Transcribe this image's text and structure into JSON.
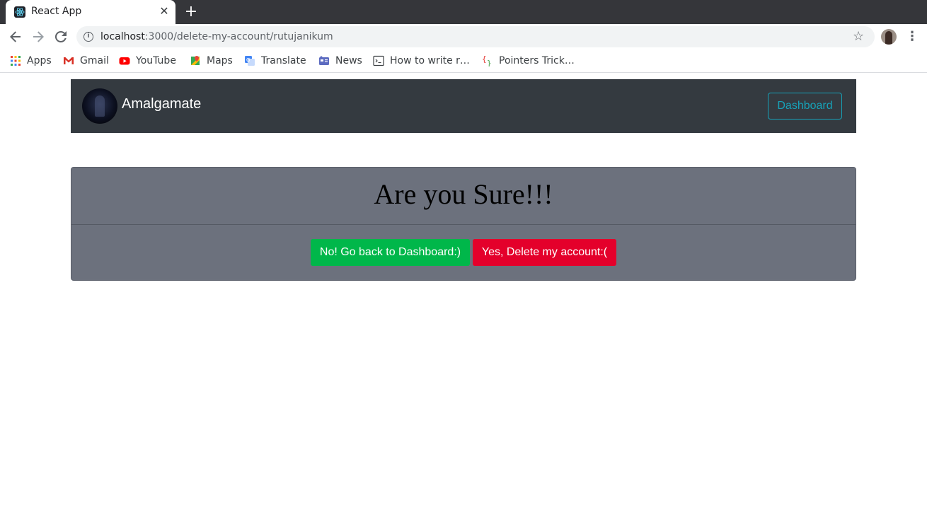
{
  "browser": {
    "tab_title": "React App",
    "url_host": "localhost",
    "url_path": ":3000/delete-my-account/rutujanikum",
    "bookmarks": [
      {
        "label": "Apps",
        "icon": "apps-grid-icon"
      },
      {
        "label": "Gmail",
        "icon": "gmail-icon"
      },
      {
        "label": "YouTube",
        "icon": "youtube-icon"
      },
      {
        "label": "Maps",
        "icon": "maps-icon"
      },
      {
        "label": "Translate",
        "icon": "translate-icon"
      },
      {
        "label": "News",
        "icon": "news-icon"
      },
      {
        "label": "How to write r…",
        "icon": "terminal-icon"
      },
      {
        "label": "Pointers Trick…",
        "icon": "braces-icon"
      }
    ]
  },
  "navbar": {
    "brand": "Amalgamate",
    "dashboard_label": "Dashboard"
  },
  "card": {
    "title": "Are you Sure!!!",
    "cancel_label": "No! Go back to Dashboard:)",
    "delete_label": "Yes, Delete my account:("
  },
  "colors": {
    "navbar_bg": "#343a40",
    "outline_info": "#17a2b8",
    "card_bg": "#6c717d",
    "success": "#00b74a",
    "danger": "#e4002b"
  }
}
